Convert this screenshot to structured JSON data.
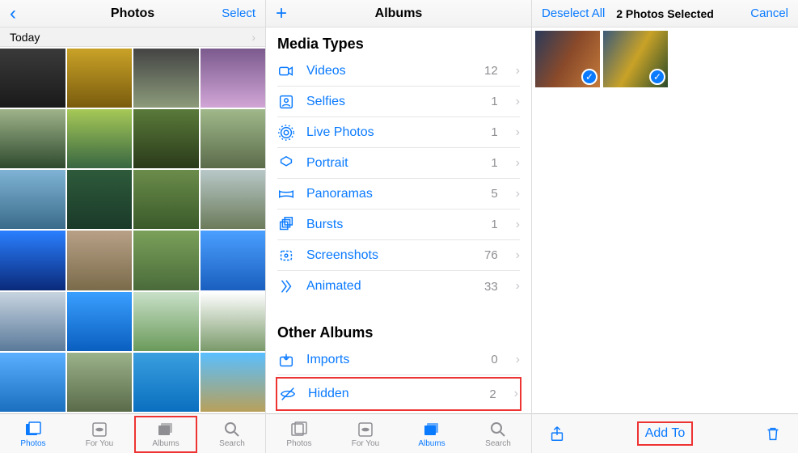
{
  "pane1": {
    "title": "Photos",
    "select": "Select",
    "today": "Today"
  },
  "pane2": {
    "title": "Albums",
    "sections": {
      "media": "Media Types",
      "other": "Other Albums"
    },
    "items": [
      {
        "label": "Videos",
        "count": "12"
      },
      {
        "label": "Selfies",
        "count": "1"
      },
      {
        "label": "Live Photos",
        "count": "1"
      },
      {
        "label": "Portrait",
        "count": "1"
      },
      {
        "label": "Panoramas",
        "count": "5"
      },
      {
        "label": "Bursts",
        "count": "1"
      },
      {
        "label": "Screenshots",
        "count": "76"
      },
      {
        "label": "Animated",
        "count": "33"
      }
    ],
    "other": [
      {
        "label": "Imports",
        "count": "0"
      },
      {
        "label": "Hidden",
        "count": "2"
      }
    ]
  },
  "pane3": {
    "deselect": "Deselect All",
    "count": "2 Photos Selected",
    "cancel": "Cancel",
    "addto": "Add To"
  },
  "tabs": {
    "photos": "Photos",
    "foryou": "For You",
    "albums": "Albums",
    "search": "Search"
  }
}
